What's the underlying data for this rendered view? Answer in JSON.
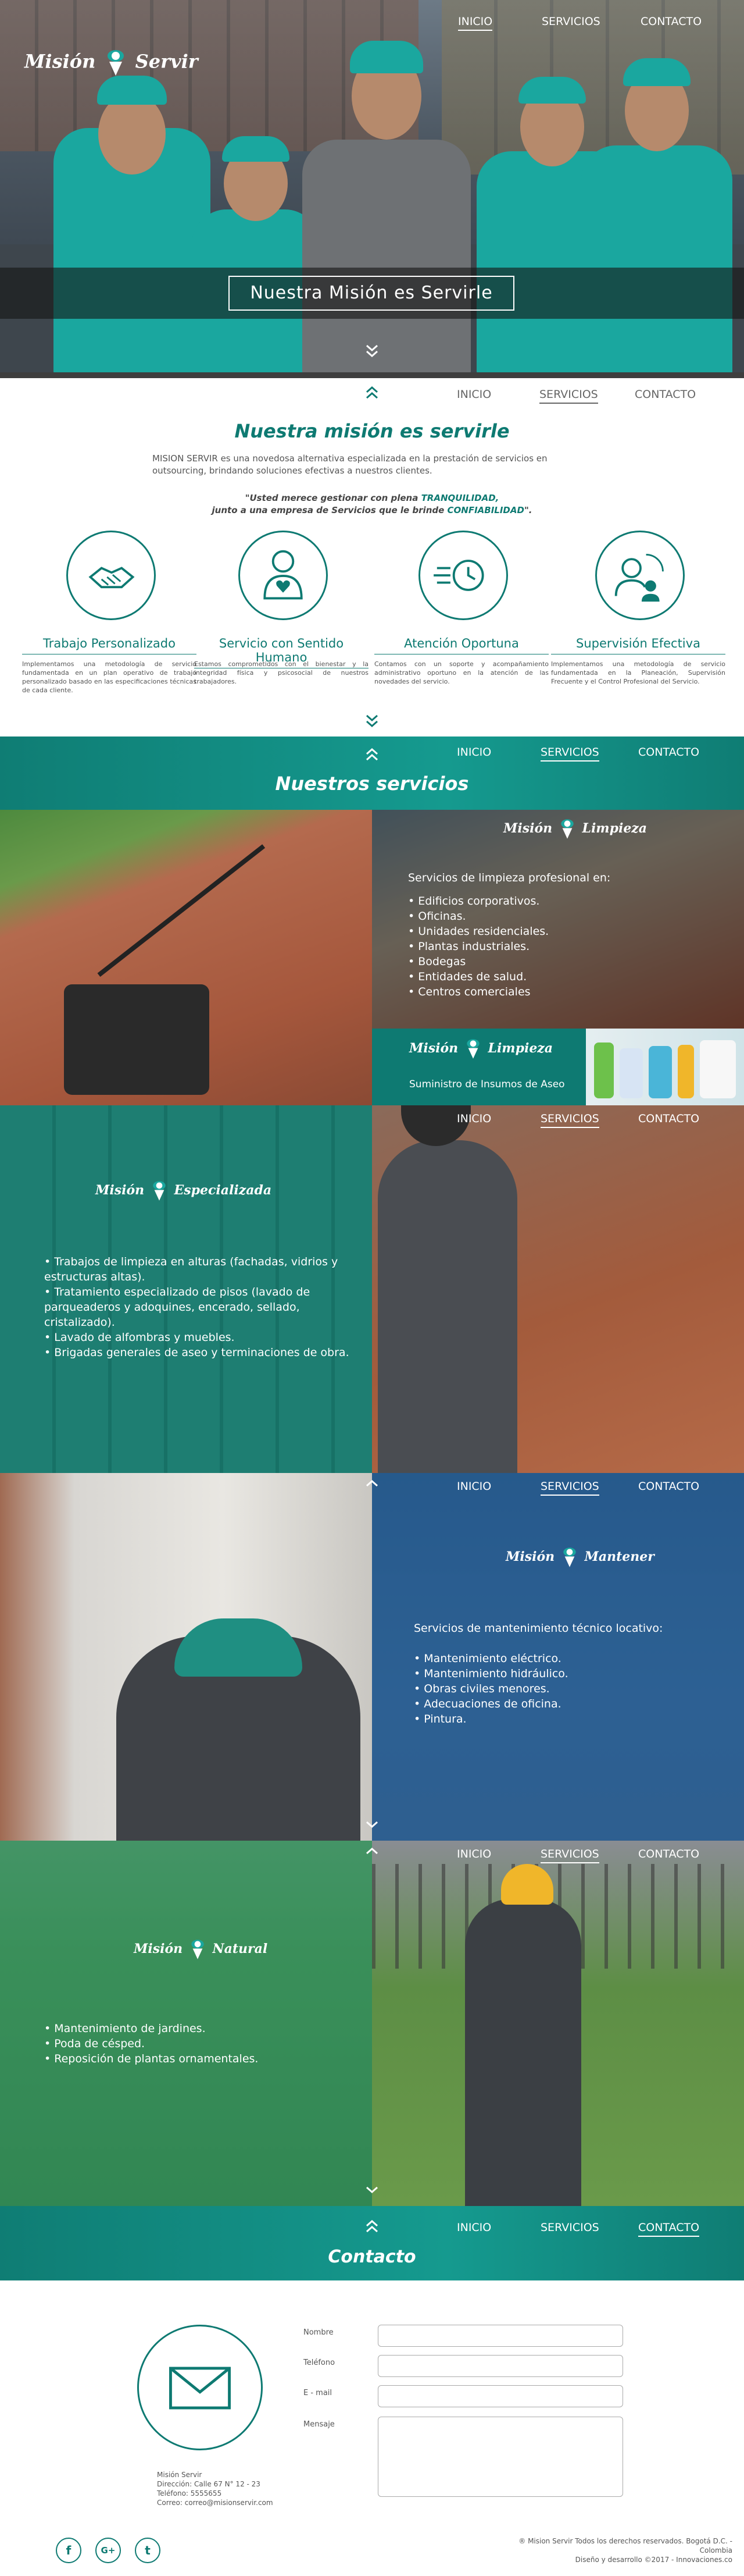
{
  "brand": {
    "logo_left": "Misión",
    "logo_right": "Servir",
    "accent": "#0e7a72",
    "accent_light": "#1aa79f"
  },
  "nav": {
    "inicio": "INICIO",
    "servicios": "SERVICIOS",
    "contacto": "CONTACTO"
  },
  "hero": {
    "title": "Nuestra Misión es Servirle"
  },
  "mission": {
    "title": "Nuestra misión es servirle",
    "description": "MISION SERVIR es una novedosa alternativa especializada en la prestación de servicios en outsourcing, brindando soluciones efectivas a nuestros clientes.",
    "quote_line1_a": "\"Usted merece gestionar con plena ",
    "quote_line1_b": "TRANQUILIDAD,",
    "quote_line2_a": "junto a una empresa de Servicios que le brinde ",
    "quote_line2_b": "CONFIABILIDAD",
    "quote_line2_c": "\"."
  },
  "features": [
    {
      "title": "Trabajo Personalizado",
      "icon": "handshake-icon",
      "desc": "Implementamos una metodología de servicio fundamentada en un plan operativo de trabajo personalizado basado en las especificaciones técnicas de cada cliente."
    },
    {
      "title": "Servicio con Sentido Humano",
      "icon": "person-heart-icon",
      "desc": "Estamos comprometidos con el bienestar y la integridad física y psicosocial de nuestros trabajadores."
    },
    {
      "title": "Atención Oportuna",
      "icon": "fast-clock-icon",
      "desc": "Contamos con un soporte y acompañamiento administrativo oportuno en la atención de las novedades del servicio."
    },
    {
      "title": "Supervisión Efectiva",
      "icon": "supervision-icon",
      "desc": "Implementamos una metodología de servicio fundamentada en la Planeación, Supervisión Frecuente y el Control Profesional del Servicio."
    }
  ],
  "services": {
    "title": "Nuestros servicios",
    "limpieza": {
      "logo_left": "Misión",
      "logo_right": "Limpieza",
      "intro": "Servicios de limpieza profesional en:",
      "items": [
        "Edificios corporativos.",
        "Oficinas.",
        "Unidades residenciales.",
        "Plantas industriales.",
        "Bodegas",
        "Entidades de salud.",
        "Centros comerciales"
      ],
      "supply": "Suministro de Insumos de Aseo"
    },
    "especializada": {
      "logo_left": "Misión",
      "logo_right": "Especializada",
      "items": [
        "Trabajos de limpieza en alturas (fachadas, vidrios y estructuras altas).",
        "Tratamiento especializado de pisos (lavado de parqueaderos y adoquines, encerado, sellado, cristalizado).",
        "Lavado de alfombras y muebles.",
        "Brigadas generales de aseo y terminaciones de obra."
      ]
    },
    "mantener": {
      "logo_left": "Misión",
      "logo_right": "Mantener",
      "intro": "Servicios de mantenimiento técnico locativo:",
      "items": [
        "Mantenimiento eléctrico.",
        "Mantenimiento hidráulico.",
        "Obras civiles menores.",
        "Adecuaciones de oficina.",
        "Pintura."
      ]
    },
    "natural": {
      "logo_left": "Misión",
      "logo_right": "Natural",
      "items": [
        "Mantenimiento de jardines.",
        "Poda de césped.",
        "Reposición de plantas ornamentales."
      ]
    }
  },
  "contact": {
    "title": "Contacto",
    "labels": {
      "name": "Nombre",
      "phone": "Teléfono",
      "email": "E - mail",
      "message": "Mensaje"
    },
    "address": [
      "Misión Servir",
      "Dirección: Calle 67 N° 12 - 23",
      "Teléfono: 5555655",
      "Correo: correo@misionservir.com"
    ],
    "copyright": "® Mision Servir Todos los derechos reservados.  Bogotá D.C. - Colombia",
    "credits": "Diseño y desarrollo ©2017 - Innovaciones.co"
  },
  "social": [
    "f",
    "G+",
    "t"
  ]
}
